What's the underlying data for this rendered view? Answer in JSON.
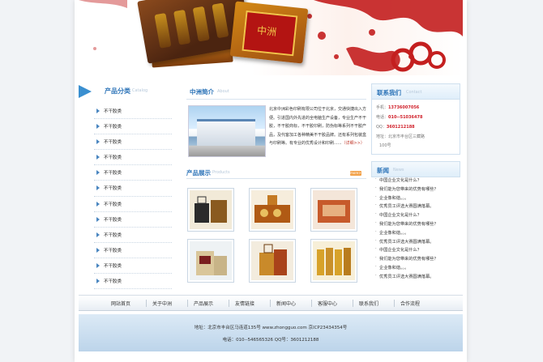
{
  "banner": {
    "box_label": "中洲"
  },
  "left": {
    "title": "产品分类",
    "title_en": "Catalog",
    "items": [
      "不干胶类",
      "不干胶类",
      "不干胶类",
      "不干胶类",
      "不干胶类",
      "不干胶类",
      "不干胶类",
      "不干胶类",
      "不干胶类",
      "不干胶类",
      "不干胶类",
      "不干胶类"
    ]
  },
  "intro": {
    "title": "中洲简介",
    "title_en": "About",
    "text": "北京中洲彩色印刷有限公司位于北京，交通快捷出入方便。引进国内外先进的全电脑生产设备，专业生产不干胶，不干胶商标，不干胶印刷，防伪标等系列不干胶产品，及代客加工各种精美不干胶品牌。还有系列包装盒与印刷等。有专业的优秀设计和印刷......",
    "more": "（详细>>）"
  },
  "products": {
    "title": "产品展示",
    "title_en": "Products",
    "more": "more>>"
  },
  "contact": {
    "title": "联系我们",
    "title_en": "Contact",
    "lines": [
      {
        "label": "手机：",
        "value": "13736007056"
      },
      {
        "label": "电话：",
        "value": "010--51036478"
      },
      {
        "label": "QQ：",
        "value": "3601212188"
      }
    ],
    "address_label": "地址：",
    "address": "北京市丰台区三藏路",
    "address2": "100号"
  },
  "news": {
    "title": "新闻",
    "title_en": "News",
    "items": [
      "中国企业文化是什么？",
      "我们能为您带来的优势有哪些？",
      "企业像和谐。。。",
      "优秀员工评选大赛圆满落幕。",
      "中国企业文化是什么？",
      "我们能为您带来的优势有哪些？",
      "企业像和谐。。。",
      "优秀员工评选大赛圆满落幕。",
      "中国企业文化是什么？",
      "我们能为您带来的优势有哪些？",
      "企业像和谐。。。",
      "优秀员工评选大赛圆满落幕。"
    ]
  },
  "nav": [
    "网站首页",
    "关于中洲",
    "产品展示",
    "友情链接",
    "新闻中心",
    "客服中心",
    "联系我们",
    "合作流程"
  ],
  "footer": {
    "line1": "地址：北京市丰台区马连道135号 www.zhongguo.com 京ICP23434354号",
    "line2": "电话：010--546565326  QQ号：3601212188"
  },
  "colors": {
    "accent": "#2d74b8",
    "highlight": "#d0202a",
    "banner_red": "#c41f1f"
  }
}
